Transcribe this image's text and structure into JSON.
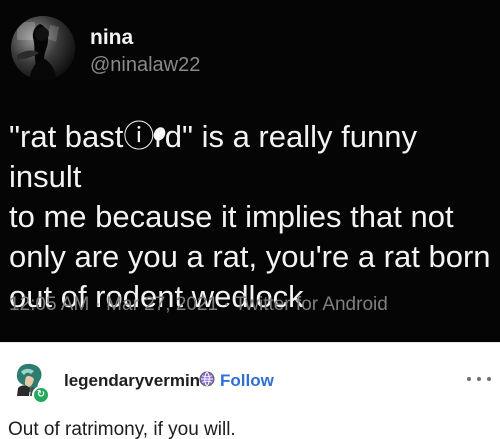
{
  "tweet": {
    "name": "nina",
    "handle": "@ninalaw22",
    "text": "\"rat bastⓘrd\" is a really funny insult\nto me because it implies that not\nonly are you a rat, you're a rat born\nout of rodent wedlock",
    "time": "12:05 AM",
    "date": "Mar 27, 2021",
    "source": "Twitter for Android",
    "separator": " · "
  },
  "reply": {
    "username": "legendaryvermin",
    "follow_label": "Follow",
    "text": "Out of ratrimony, if you will."
  },
  "icons": {
    "tweet_avatar": "profile-photo-icon",
    "reply_avatar": "avatar-icon",
    "reply_badge": "reblog-badge-icon",
    "reply_globe": "globe-icon",
    "more": "more-options-icon"
  },
  "colors": {
    "tweet_background": "#050505",
    "tweet_text": "#f3f3f3",
    "tweet_meta": "#7f7f7f",
    "reply_background": "#ffffff",
    "follow": "#2f6fd6",
    "badge": "#23a95b"
  }
}
